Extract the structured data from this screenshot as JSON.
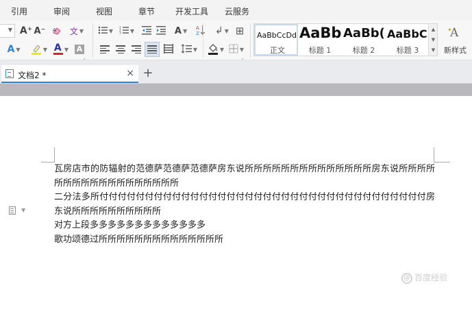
{
  "menu": {
    "tabs": [
      "引用",
      "审阅",
      "视图",
      "章节",
      "开发工具",
      "云服务"
    ]
  },
  "ribbon": {
    "font_grow": "A⁺",
    "font_shrink": "A⁻",
    "clear_format": "A",
    "phonetic_glyph": "文",
    "font_color_glyph": "A",
    "char_shade_glyph": "A",
    "text_effect_glyph": "A",
    "line_spacing_glyph": "A",
    "sort_glyph": "↓",
    "show_marks_glyph": "↲",
    "table_glyph": "⊞",
    "fill_glyph": "◈",
    "border_glyph": "⊡",
    "styles": [
      {
        "sample": "AaBbCcDd",
        "name": "正文"
      },
      {
        "sample": "AaBb",
        "name": "标题 1"
      },
      {
        "sample": "AaBb(",
        "name": "标题 2"
      },
      {
        "sample": "AaBbC",
        "name": "标题 3"
      }
    ],
    "new_style_label": "新样式",
    "new_style_glyph": "A"
  },
  "tabs": {
    "document_title": "文档2 *",
    "close_glyph": "×",
    "add_glyph": "+"
  },
  "document": {
    "paragraphs": [
      "瓦房店市的防辐射的范德萨范德萨范德萨房东说所所所所所所所所所所所所所所房东说所所所所所所所所所所所所所所所所所所",
      "二分法多所付付付付付付付付付付付付付付付付付付付付付付付付付付付付付付付付付付付付房东说所所所所所所所所所所",
      "对方上段多多多多多多多多多多多多多",
      "歌功颂德过所所所所所所所所所所所所所所"
    ]
  },
  "watermark": {
    "text": "百度经验"
  },
  "colors": {
    "accent": "#2c84d8",
    "font_color_bar": "#e02020",
    "highlight_bar": "#f5e600"
  }
}
